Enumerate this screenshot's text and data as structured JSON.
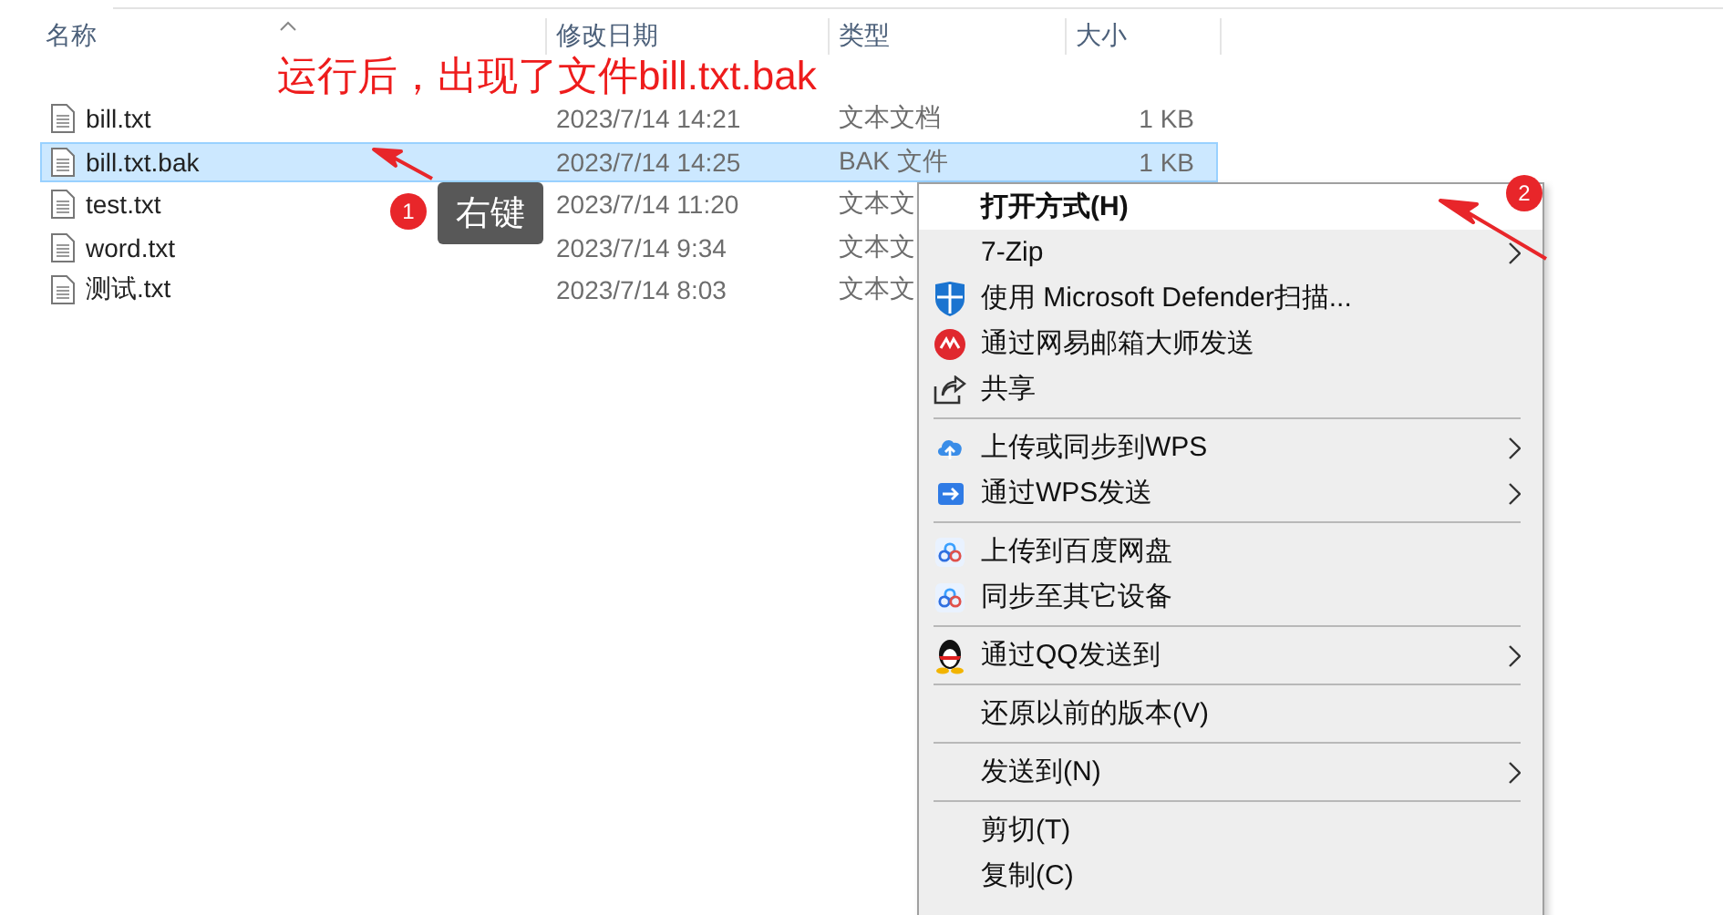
{
  "columns": [
    {
      "label": "名称"
    },
    {
      "label": "修改日期"
    },
    {
      "label": "类型"
    },
    {
      "label": "大小"
    }
  ],
  "files": [
    {
      "name": "bill.txt",
      "modified": "2023/7/14 14:21",
      "type": "文本文档",
      "size": "1 KB",
      "selected": false
    },
    {
      "name": "bill.txt.bak",
      "modified": "2023/7/14 14:25",
      "type": "BAK 文件",
      "size": "1 KB",
      "selected": true
    },
    {
      "name": "test.txt",
      "modified": "2023/7/14 11:20",
      "type": "文本文",
      "selected": false
    },
    {
      "name": "word.txt",
      "modified": "2023/7/14 9:34",
      "type": "文本文",
      "selected": false
    },
    {
      "name": "测试.txt",
      "modified": "2023/7/14 8:03",
      "type": "文本文",
      "selected": false
    }
  ],
  "context_menu": {
    "items": [
      {
        "kind": "item",
        "label": "打开方式(H)",
        "default": true,
        "submenu": false,
        "selected": true
      },
      {
        "kind": "item",
        "label": "7-Zip",
        "default": false,
        "submenu": true,
        "selected": false
      },
      {
        "kind": "item",
        "label": "使用 Microsoft Defender扫描...",
        "default": false,
        "submenu": false,
        "selected": false
      },
      {
        "kind": "item",
        "label": "通过网易邮箱大师发送",
        "default": false,
        "submenu": false,
        "selected": false
      },
      {
        "kind": "item",
        "label": "共享",
        "default": false,
        "submenu": false,
        "selected": false
      },
      {
        "kind": "separator"
      },
      {
        "kind": "item",
        "label": "上传或同步到WPS",
        "default": false,
        "submenu": true,
        "selected": false
      },
      {
        "kind": "item",
        "label": "通过WPS发送",
        "default": false,
        "submenu": true,
        "selected": false
      },
      {
        "kind": "separator"
      },
      {
        "kind": "item",
        "label": "上传到百度网盘",
        "default": false,
        "submenu": false,
        "selected": false
      },
      {
        "kind": "item",
        "label": "同步至其它设备",
        "default": false,
        "submenu": false,
        "selected": false
      },
      {
        "kind": "separator"
      },
      {
        "kind": "item",
        "label": "通过QQ发送到",
        "default": false,
        "submenu": true,
        "selected": false
      },
      {
        "kind": "separator"
      },
      {
        "kind": "item",
        "label": "还原以前的版本(V)",
        "default": false,
        "submenu": false,
        "selected": false
      },
      {
        "kind": "separator"
      },
      {
        "kind": "item",
        "label": "发送到(N)",
        "default": false,
        "submenu": true,
        "selected": false
      },
      {
        "kind": "separator"
      },
      {
        "kind": "item",
        "label": "剪切(T)",
        "default": false,
        "submenu": false,
        "selected": false
      },
      {
        "kind": "item",
        "label": "复制(C)",
        "default": false,
        "submenu": false,
        "selected": false
      }
    ]
  },
  "annotations": {
    "caption": "运行后，出现了文件bill.txt.bak",
    "callouts": [
      {
        "number": "1",
        "tooltip": "右键"
      },
      {
        "number": "2"
      }
    ]
  }
}
